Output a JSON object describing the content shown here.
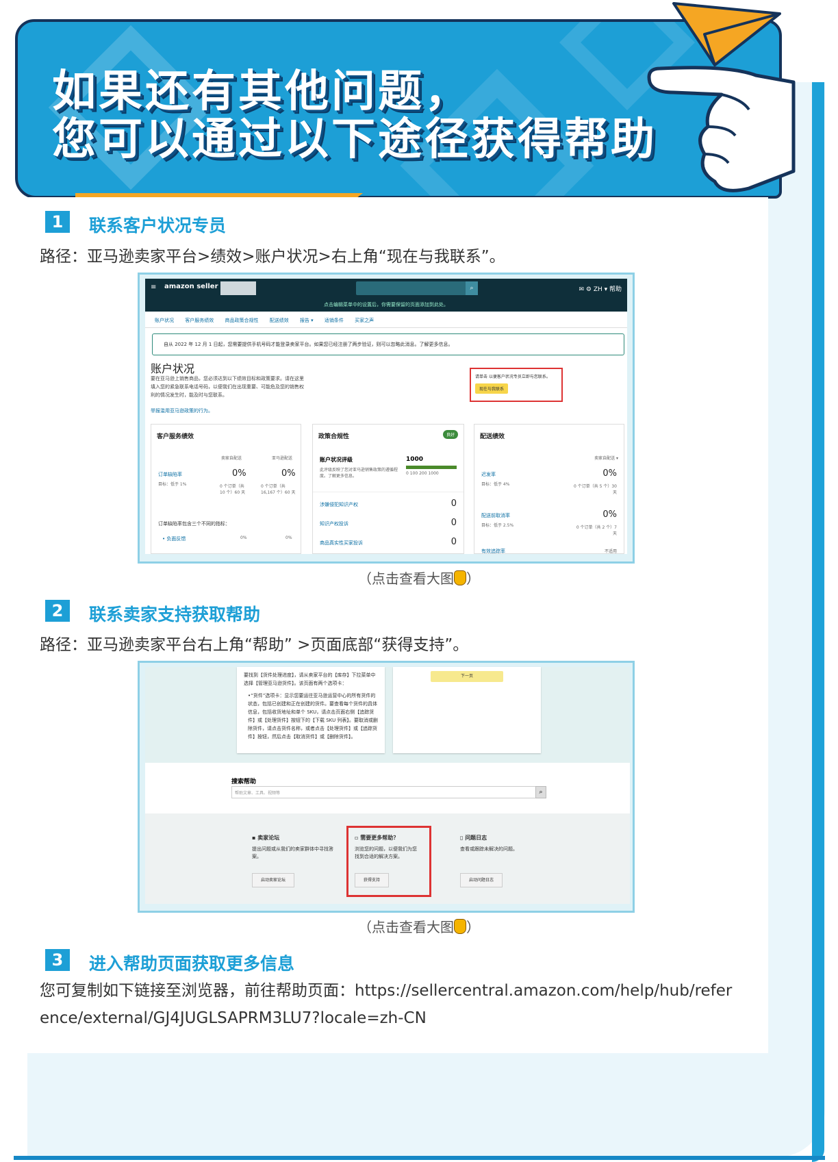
{
  "banner": {
    "title_line1": "如果还有其他问题，",
    "title_line2": "您可以通过以下途径获得帮助"
  },
  "sections": [
    {
      "num": "1",
      "title": "联系客户状况专员",
      "path": "路径：亚马逊卖家平台>绩效>账户状况>右上角“现在与我联系”。",
      "caption": "（点击查看大图",
      "caption_end": "）"
    },
    {
      "num": "2",
      "title": "联系卖家支持获取帮助",
      "path": "路径：亚马逊卖家平台右上角“帮助” >页面底部“获得支持”。",
      "caption": "（点击查看大图",
      "caption_end": "）"
    },
    {
      "num": "3",
      "title": "进入帮助页面获取更多信息",
      "text": "您可复制如下链接至浏览器，前往帮助页面：https://sellercentral.amazon.com/help/hub/reference/external/GJ4JUGLSAPRM3LU7?locale=zh-CN"
    }
  ],
  "shot1": {
    "logo": "amazon seller central",
    "right": "✉ ⚙ ZH ▾ 帮助",
    "notice": "点击编辑菜单中的设置后，你需要保留的页面添加到此处。",
    "nav": [
      "账户状况",
      "客户服务绩效",
      "商品政策合规性",
      "配送绩效",
      "报告 ▾",
      "适销条件",
      "买家之声"
    ],
    "alert": "自从 2022 年 12 月 1 日起，您需要提供手机号码才能登录卖家平台。如果您已经注册了两步验证，则可以忽略此消息。了解更多信息。",
    "heading": "账户状况",
    "intro": "要在亚马逊上销售商品，您必须达到以下绩效目标和政策要求。请在这里填入您的紧急联系电话号码，以便我们在出现重要、可能危及您的销售权利的情况发生时，能及时与您联系。",
    "report_link": "举报滥用亚马逊政策的行为。",
    "contact_text": "请单击 以便客户状况专员立即与您联系。",
    "contact_btn": "现在与我联系",
    "panel1": {
      "title": "客户服务绩效",
      "col1": "卖家自配送",
      "col2": "亚马逊配送",
      "label": "订单缺陷率",
      "target": "目标：低于 1%",
      "v1": "0%",
      "v2": "0%",
      "sub1": "0 个订单（共 10 个）60 天",
      "sub2": "0 个订单（共 16,167 个）60 天",
      "note": "订单缺陷率包含三个不同的指标：",
      "bullet": "• 负面反馈",
      "b1": "0%",
      "b2": "0%"
    },
    "panel2": {
      "title": "政策合规性",
      "badge": "良好",
      "score_label": "账户状况评级",
      "score": "1000",
      "score_desc": "此评级反映了您对亚马逊销售政策的遵循程度。了解更多信息。",
      "ticks": "0   100   200   1000",
      "rows": [
        {
          "label": "涉嫌侵犯知识产权",
          "val": "0"
        },
        {
          "label": "知识产权投诉",
          "val": "0"
        },
        {
          "label": "商品真实性买家投诉",
          "val": "0"
        }
      ]
    },
    "panel3": {
      "title": "配送绩效",
      "col": "卖家自配送 ▾",
      "r1": "迟发率",
      "t1": "目标：低于 4%",
      "v1": "0%",
      "s1": "0 个订单（共 5 个）30 天",
      "r2": "配送前取消率",
      "t2": "目标：低于 2.5%",
      "v2": "0%",
      "s2": "0 个订单（共 2 个）7 天",
      "r3": "有效追踪率",
      "v3": "不适用"
    }
  },
  "shot2": {
    "card_text": "要找到【货件处理进度】，请从卖家平台的【库存】下拉菜单中选择【管理亚马逊货件】。该页面有两个选项卡：",
    "bullet": "•“货件”选项卡：显示您要运往亚马逊运营中心的所有货件的状态，包括已创建和正在创建的货件。要查看每个货件的具体信息，包括收货地址和单个 SKU，请点击页面右侧【追踪货件】或【处理货件】按钮下的【下载 SKU 列表】。要取消或删除货件，请点击货件名称，或者点击【处理货件】或【追踪货件】按钮，然后点击【取消货件】或【删除货件】。",
    "next_btn": "下一页",
    "search_label": "搜索帮助",
    "search_placeholder": "帮助文章、工具、视频等",
    "col1": {
      "title": "卖家论坛",
      "desc": "提出问题或从我们的卖家群体中寻找答案。",
      "btn": "启动卖家论坛"
    },
    "col2": {
      "title": "需要更多帮助？",
      "desc": "浏览您的问题，以便我们为您找到合适的解决方案。",
      "btn": "获得支持"
    },
    "col3": {
      "title": "问题日志",
      "desc": "查看或跟踪未解决的问题。",
      "btn": "启动问题日志"
    }
  },
  "colors": {
    "accent": "#1d9fd6",
    "dark": "#15335a",
    "orange": "#f5a623",
    "highlight": "#d33"
  }
}
